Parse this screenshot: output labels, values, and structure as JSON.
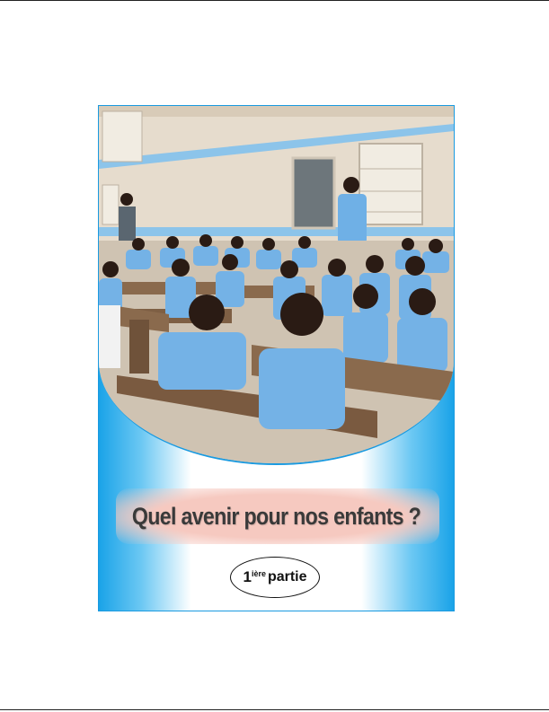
{
  "cover": {
    "title": "Quel avenir pour nos enfants ?",
    "part": {
      "number": "1",
      "superscript": "ière",
      "word": "partie"
    }
  },
  "colors": {
    "accent_blue": "#1aa3e8",
    "title_band": "#f6c9c0",
    "title_text": "#3a3a3a",
    "uniform_blue": "#6fb0e6"
  },
  "photo": {
    "subject": "classroom-photo"
  }
}
